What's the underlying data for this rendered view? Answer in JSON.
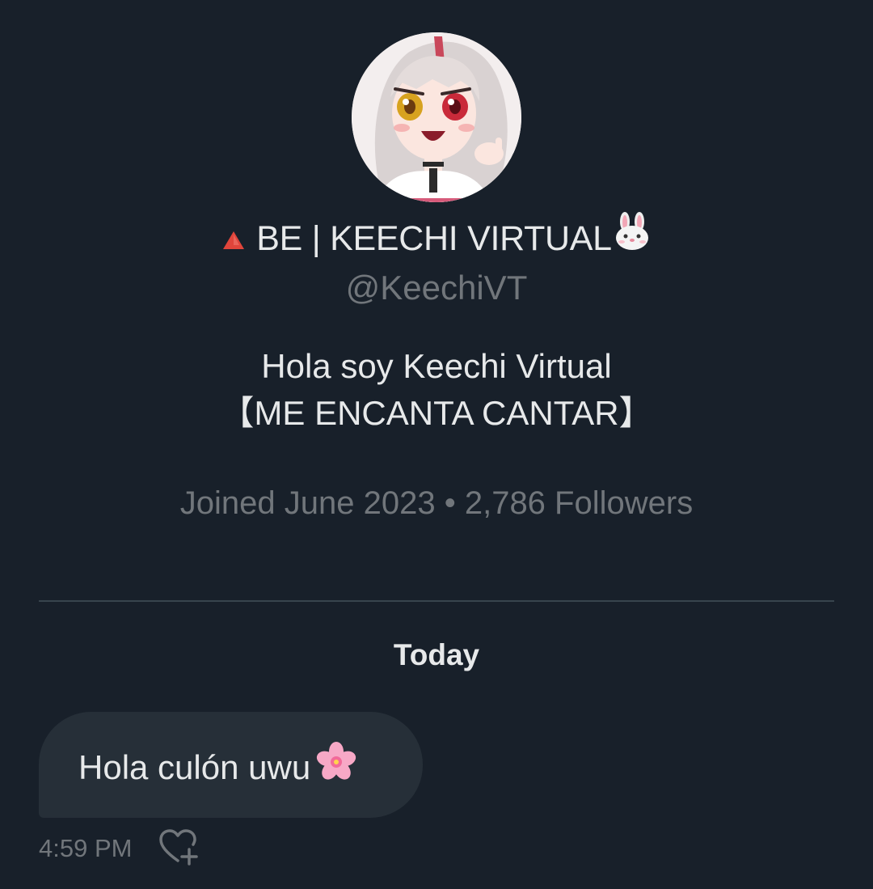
{
  "profile": {
    "avatar_alt": "avatar",
    "display_name": "BE | KEECHI VIRTUAL",
    "name_prefix_icon": "red-triangle-icon",
    "name_suffix_icon": "rabbit-face-icon",
    "handle": "@KeechiVT",
    "bio_line1": "Hola soy Keechi Virtual",
    "bio_line2": "【ME ENCANTA CANTAR】",
    "meta": "Joined June 2023 • 2,786 Followers"
  },
  "conversation": {
    "date_separator": "Today",
    "messages": [
      {
        "text": "Hola culón uwu",
        "emoji_icon": "cherry-blossom-icon",
        "time": "4:59 PM",
        "reaction_icon": "add-reaction-heart-icon"
      }
    ]
  },
  "colors": {
    "background": "#18202a",
    "bubble": "#262f38",
    "primary_text": "#e7e9ea",
    "secondary_text": "#71767b",
    "divider": "#38444d"
  }
}
